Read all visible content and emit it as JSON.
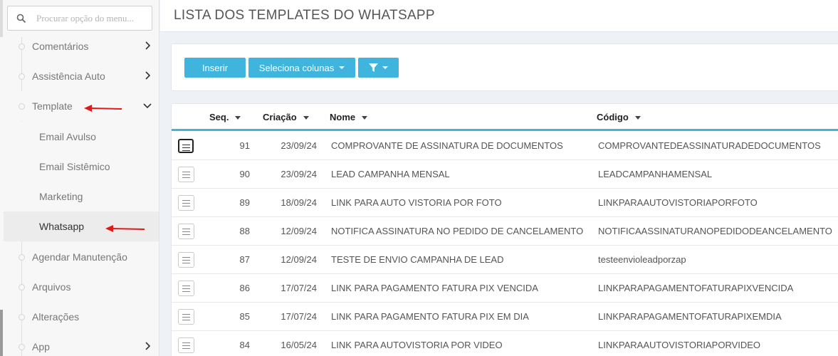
{
  "sidebar": {
    "search_placeholder": "Procurar opção do menu...",
    "items": [
      {
        "label": "Comentários",
        "chevron": "right"
      },
      {
        "label": "Assistência Auto",
        "chevron": "right"
      },
      {
        "label": "Template",
        "chevron": "down"
      },
      {
        "label": "Agendar Manutenção"
      },
      {
        "label": "Arquivos"
      },
      {
        "label": "Alterações"
      },
      {
        "label": "App",
        "chevron": "right"
      }
    ],
    "submenu": [
      {
        "label": "Email Avulso"
      },
      {
        "label": "Email Sistêmico"
      },
      {
        "label": "Marketing"
      },
      {
        "label": "Whatsapp",
        "active": true
      }
    ]
  },
  "header": {
    "title": "LISTA DOS TEMPLATES DO WHATSAPP"
  },
  "toolbar": {
    "insert_label": "Inserir",
    "columns_label": "Seleciona colunas"
  },
  "table": {
    "headers": {
      "seq": "Seq.",
      "criacao": "Criação",
      "nome": "Nome",
      "codigo": "Código"
    },
    "rows": [
      {
        "seq": "91",
        "criacao": "23/09/24",
        "nome": "COMPROVANTE DE ASSINATURA DE DOCUMENTOS",
        "codigo": "COMPROVANTEDEASSINATURADEDOCUMENTOS"
      },
      {
        "seq": "90",
        "criacao": "23/09/24",
        "nome": "LEAD CAMPANHA MENSAL",
        "codigo": "LEADCAMPANHAMENSAL"
      },
      {
        "seq": "89",
        "criacao": "18/09/24",
        "nome": "LINK PARA AUTO VISTORIA POR FOTO",
        "codigo": "LINKPARAAUTOVISTORIAPORFOTO"
      },
      {
        "seq": "88",
        "criacao": "12/09/24",
        "nome": "NOTIFICA ASSINATURA NO PEDIDO DE CANCELAMENTO",
        "codigo": "NOTIFICAASSINATURANOPEDIDODEANCELAMENTO"
      },
      {
        "seq": "87",
        "criacao": "12/09/24",
        "nome": "TESTE DE ENVIO CAMPANHA DE LEAD",
        "codigo": "testeenvioleadporzap"
      },
      {
        "seq": "86",
        "criacao": "17/07/24",
        "nome": "LINK PARA PAGAMENTO FATURA PIX VENCIDA",
        "codigo": "LINKPARAPAGAMENTOFATURAPIXVENCIDA"
      },
      {
        "seq": "85",
        "criacao": "17/07/24",
        "nome": "LINK PARA PAGAMENTO FATURA PIX EM DIA",
        "codigo": "LINKPARAPAGAMENTOFATURAPIXEMDIA"
      },
      {
        "seq": "84",
        "criacao": "16/05/24",
        "nome": "LINK PARA AUTOVISTORIA POR VIDEO",
        "codigo": "LINKPARAAUTOVISTORIAPORVIDEO"
      }
    ]
  },
  "colors": {
    "accent": "#3fb4dc",
    "arrow": "#e0191b"
  },
  "icons": {
    "search": "search-icon",
    "filter": "filter-icon",
    "row_menu": "hamburger-icon",
    "chevron_right": "chevron-right-icon",
    "chevron_down": "chevron-down-icon",
    "annotation": "red-arrow-icon"
  }
}
